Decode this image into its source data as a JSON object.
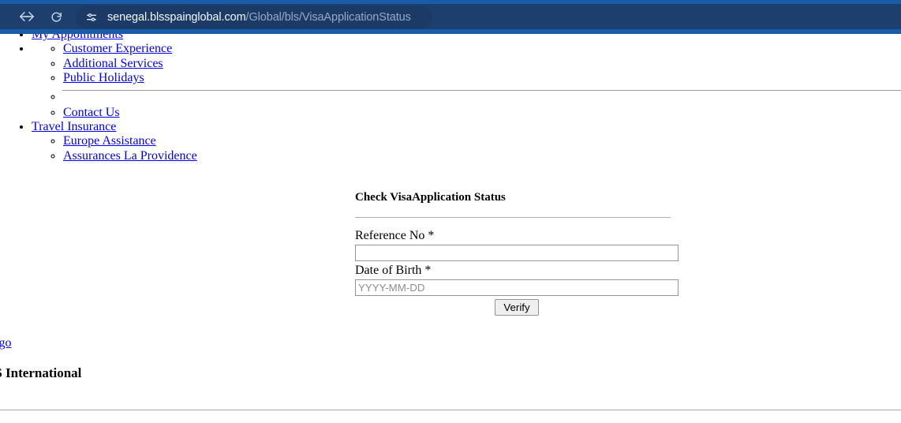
{
  "browser": {
    "back_icon": "arrow-left-icon",
    "forward_icon": "arrow-right-icon",
    "reload_icon": "reload-icon",
    "site_settings_icon": "tune-sliders-icon",
    "url_host": "senegal.blsspainglobal.com",
    "url_path": "/Global/bls/VisaApplicationStatus",
    "colors": {
      "chrome_accent": "#1a5ca9",
      "omnibox_background": "#1b3a66",
      "bar_background": "#1d3f6e",
      "host_text": "#f4f8fc",
      "path_text": "#93aac6"
    }
  },
  "nav": {
    "items": [
      {
        "label": "My Appointments",
        "level": 1
      },
      {
        "label": "Customer Experience",
        "level": 2,
        "parent_marker": true
      },
      {
        "label": "Additional Services",
        "level": 2
      },
      {
        "label": "Public Holidays",
        "level": 2
      },
      {
        "label": "",
        "level": 2,
        "divider": true
      },
      {
        "label": "Contact Us",
        "level": 2
      },
      {
        "label": "Travel Insurance",
        "level": 1
      },
      {
        "label": "Europe Assistance",
        "level": 2
      },
      {
        "label": "Assurances La Providence",
        "level": 2
      }
    ]
  },
  "form": {
    "title": "Check VisaApplication Status",
    "reference_label": "Reference No *",
    "reference_value": "",
    "reference_placeholder": "",
    "dob_label": "Date of Birth *",
    "dob_value": "",
    "dob_placeholder": "YYYY-MM-DD",
    "verify_label": "Verify"
  },
  "footer": {
    "logo_link": "logo",
    "brand": "LS International"
  },
  "colors": {
    "link": "#0000ee",
    "text": "#000000",
    "rule": "#9a9a9a",
    "input_border": "#949494",
    "button_background": "#efefef"
  }
}
